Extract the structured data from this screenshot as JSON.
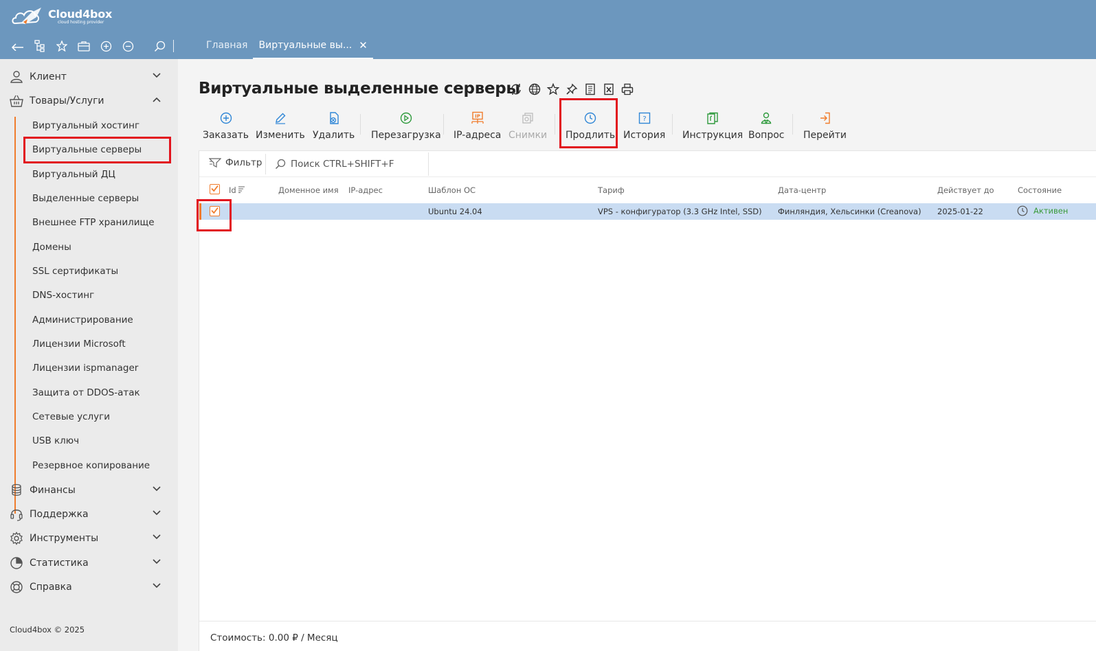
{
  "header": {
    "logo_name": "Cloud4box",
    "logo_tagline": "cloud hosting provider",
    "tools": [
      "back-icon",
      "tree-icon",
      "star-icon",
      "briefcase-icon",
      "zoom-in-icon",
      "zoom-out-icon",
      "search-icon"
    ],
    "tabs": [
      {
        "label": "Главная",
        "active": false
      },
      {
        "label": "Виртуальные вы...",
        "active": true,
        "close": "✕"
      }
    ]
  },
  "sidebar": {
    "sections": [
      {
        "label": "Клиент",
        "icon": "user-icon",
        "expanded": false
      },
      {
        "label": "Товары/Услуги",
        "icon": "basket-icon",
        "expanded": true
      },
      {
        "label": "Финансы",
        "icon": "coins-icon",
        "expanded": false
      },
      {
        "label": "Поддержка",
        "icon": "headset-icon",
        "expanded": false
      },
      {
        "label": "Инструменты",
        "icon": "gear-icon",
        "expanded": false
      },
      {
        "label": "Статистика",
        "icon": "pie-chart-icon",
        "expanded": false
      },
      {
        "label": "Справка",
        "icon": "lifebuoy-icon",
        "expanded": false
      }
    ],
    "sub_items": [
      "Виртуальный хостинг",
      "Виртуальные серверы",
      "Виртуальный ДЦ",
      "Выделенные серверы",
      "Внешнее FTP хранилище",
      "Домены",
      "SSL сертификаты",
      "DNS-хостинг",
      "Администрирование",
      "Лицензии Microsoft",
      "Лицензии ispmanager",
      "Защита от DDOS-атак",
      "Сетевые услуги",
      "USB ключ",
      "Резервное копирование"
    ],
    "selected_sub_item": "Виртуальные серверы",
    "footer": "Cloud4box © 2025"
  },
  "main": {
    "title": "Виртуальные выделенные серверы",
    "title_icons": [
      "refresh-icon",
      "globe-icon",
      "star-icon",
      "pin-icon",
      "document-icon",
      "excel-icon",
      "print-icon"
    ],
    "toolbar": [
      {
        "label": "Заказать",
        "icon": "plus-circle-icon",
        "color": "#2f86d6",
        "enabled": true
      },
      {
        "label": "Изменить",
        "icon": "pencil-icon",
        "color": "#2f86d6",
        "enabled": true
      },
      {
        "label": "Удалить",
        "icon": "delete-icon",
        "color": "#2f86d6",
        "enabled": true
      },
      {
        "label": "Перезагрузка",
        "icon": "restart-icon",
        "color": "#2e9a3c",
        "enabled": true
      },
      {
        "label": "IP-адреса",
        "icon": "ip-icon",
        "color": "#f07c2c",
        "enabled": true
      },
      {
        "label": "Снимки",
        "icon": "snapshot-icon",
        "color": "#bbbbbb",
        "enabled": false
      },
      {
        "label": "Продлить",
        "icon": "clock-icon",
        "color": "#2f86d6",
        "enabled": true
      },
      {
        "label": "История",
        "icon": "history-icon",
        "color": "#2f86d6",
        "enabled": true
      },
      {
        "label": "Инструкция",
        "icon": "instruction-icon",
        "color": "#2e9a3c",
        "enabled": true
      },
      {
        "label": "Вопрос",
        "icon": "question-user-icon",
        "color": "#2e9a3c",
        "enabled": true
      },
      {
        "label": "Перейти",
        "icon": "goto-icon",
        "color": "#f07c2c",
        "enabled": true
      }
    ],
    "filter_label": "Фильтр",
    "search_placeholder": "Поиск CTRL+SHIFT+F",
    "columns": [
      "Id",
      "Доменное имя",
      "IP-адрес",
      "Шаблон ОС",
      "Тариф",
      "Дата-центр",
      "Действует до",
      "Состояние"
    ],
    "rows": [
      {
        "selected": true,
        "id": "",
        "domain": "",
        "ip": "",
        "os": "Ubuntu 24.04",
        "tariff": "VPS - конфигуратор (3.3 GHz Intel, SSD)",
        "datacenter": "Финляндия, Хельсинки (Creanova)",
        "valid_until": "2025-01-22",
        "status": "Активен"
      }
    ],
    "cost": "Стоимость: 0.00 ₽ / Месяц"
  },
  "colors": {
    "header_bg": "#6c97be",
    "accent_orange": "#f07c2c",
    "row_selected": "#c9dcf2",
    "highlight_red": "#e2141e",
    "status_green": "#3a9a3a"
  }
}
